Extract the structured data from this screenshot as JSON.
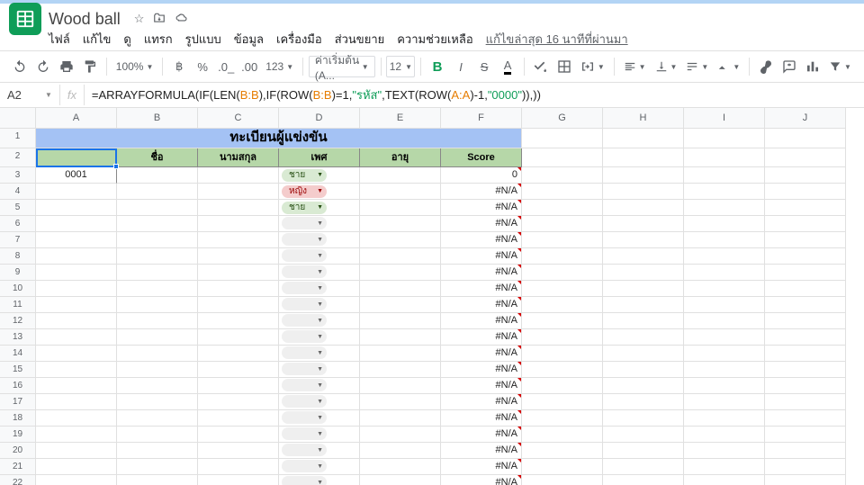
{
  "doc": {
    "title": "Wood ball"
  },
  "menus": [
    "ไฟล์",
    "แก้ไข",
    "ดู",
    "แทรก",
    "รูปแบบ",
    "ข้อมูล",
    "เครื่องมือ",
    "ส่วนขยาย",
    "ความช่วยเหลือ"
  ],
  "lastedit": "แก้ไขล่าสุด 16 นาทีที่ผ่านมา",
  "toolbar": {
    "zoom": "100%",
    "font": "ค่าเริ่มต้น (A...",
    "size": "12"
  },
  "fx": {
    "cell": "A2",
    "pre": "=ARRAYFORMULA(IF(LEN(",
    "r1": "B:B",
    "mid1": "),IF(ROW(",
    "r2": "B:B",
    "mid2": ")=1,",
    "s1": "\"รหัส\"",
    "mid3": ",TEXT(ROW(",
    "r3": "A:A",
    "mid4": ")-1,",
    "s2": "\"0000\"",
    "tail": ")),))"
  },
  "cols": [
    "A",
    "B",
    "C",
    "D",
    "E",
    "F",
    "G",
    "H",
    "I",
    "J"
  ],
  "colw": {
    "A": 90,
    "B": 90,
    "C": 90,
    "D": 90,
    "E": 90,
    "F": 90,
    "G": 90,
    "H": 90,
    "I": 90,
    "J": 90
  },
  "title": "ทะเบียนผู้แข่งขัน",
  "headers": [
    "",
    "ชื่อ",
    "นามสกุล",
    "เพศ",
    "อายุ",
    "Score"
  ],
  "chips": {
    "m": "ชาย",
    "f": "หญิง"
  },
  "rows": [
    {
      "n": 3,
      "a": "0001",
      "chip": "m",
      "f": "0",
      "tri": true
    },
    {
      "n": 4,
      "chip": "f",
      "f": "#N/A",
      "tri": true
    },
    {
      "n": 5,
      "chip": "m",
      "f": "#N/A",
      "tri": true
    },
    {
      "n": 6,
      "chip": "e",
      "f": "#N/A",
      "tri": true
    },
    {
      "n": 7,
      "chip": "e",
      "f": "#N/A",
      "tri": true
    },
    {
      "n": 8,
      "chip": "e",
      "f": "#N/A",
      "tri": true
    },
    {
      "n": 9,
      "chip": "e",
      "f": "#N/A",
      "tri": true
    },
    {
      "n": 10,
      "chip": "e",
      "f": "#N/A",
      "tri": true
    },
    {
      "n": 11,
      "chip": "e",
      "f": "#N/A",
      "tri": true
    },
    {
      "n": 12,
      "chip": "e",
      "f": "#N/A",
      "tri": true
    },
    {
      "n": 13,
      "chip": "e",
      "f": "#N/A",
      "tri": true
    },
    {
      "n": 14,
      "chip": "e",
      "f": "#N/A",
      "tri": true
    },
    {
      "n": 15,
      "chip": "e",
      "f": "#N/A",
      "tri": true
    },
    {
      "n": 16,
      "chip": "e",
      "f": "#N/A",
      "tri": true
    },
    {
      "n": 17,
      "chip": "e",
      "f": "#N/A",
      "tri": true
    },
    {
      "n": 18,
      "chip": "e",
      "f": "#N/A",
      "tri": true
    },
    {
      "n": 19,
      "chip": "e",
      "f": "#N/A",
      "tri": true
    },
    {
      "n": 20,
      "chip": "e",
      "f": "#N/A",
      "tri": true
    },
    {
      "n": 21,
      "chip": "e",
      "f": "#N/A",
      "tri": true
    },
    {
      "n": 22,
      "chip": "e",
      "f": "#N/A",
      "tri": true
    }
  ]
}
